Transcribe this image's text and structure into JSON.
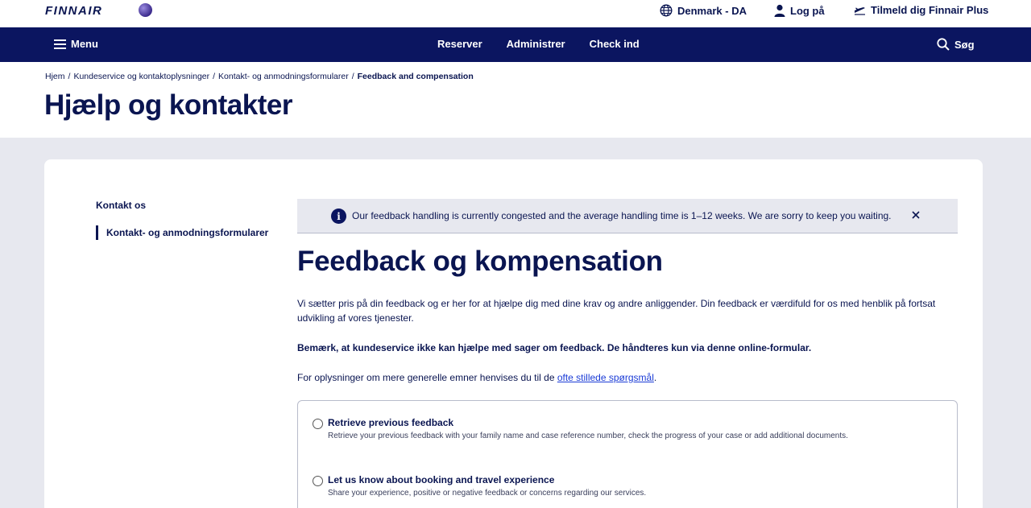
{
  "header": {
    "logo": "FINNAIR",
    "locale": "Denmark - DA",
    "login": "Log på",
    "signup": "Tilmeld dig Finnair Plus"
  },
  "nav": {
    "menu": "Menu",
    "links": [
      "Reserver",
      "Administrer",
      "Check ind"
    ],
    "search": "Søg"
  },
  "breadcrumb": {
    "items": [
      "Hjem",
      "Kundeservice og kontaktoplysninger",
      "Kontakt- og anmodningsformularer"
    ],
    "current": "Feedback and compensation",
    "separator": "/"
  },
  "page_title": "Hjælp og kontakter",
  "sidebar": {
    "title": "Kontakt os",
    "active_item": "Kontakt- og anmodningsformularer"
  },
  "notice": {
    "icon": "i",
    "text": "Our feedback handling is currently congested and the average handling time is 1–12 weeks. We are sorry to keep you waiting."
  },
  "main": {
    "title": "Feedback og kompensation",
    "paragraph1": "Vi sætter pris på din feedback og er her for at hjælpe dig med dine krav og andre anliggender. Din feedback er værdifuld for os med henblik på fortsat udvikling af vores tjenester.",
    "paragraph2": "Bemærk, at kundeservice ikke kan hjælpe med sager om feedback. De håndteres kun via denne online-formular.",
    "paragraph3_prefix": "For oplysninger om mere generelle emner henvises du til de ",
    "paragraph3_link": "ofte stillede spørgsmål",
    "paragraph3_suffix": "."
  },
  "options": [
    {
      "title": "Retrieve previous feedback",
      "description": "Retrieve your previous feedback with your family name and case reference number, check the progress of your case or add additional documents."
    },
    {
      "title": "Let us know about booking and travel experience",
      "description": "Share your experience, positive or negative feedback or concerns regarding our services."
    }
  ],
  "colors": {
    "brand_navy": "#0b1560",
    "text_navy": "#0a1551",
    "background_grey": "#e7e8ef",
    "link_blue": "#1a3bd6"
  }
}
